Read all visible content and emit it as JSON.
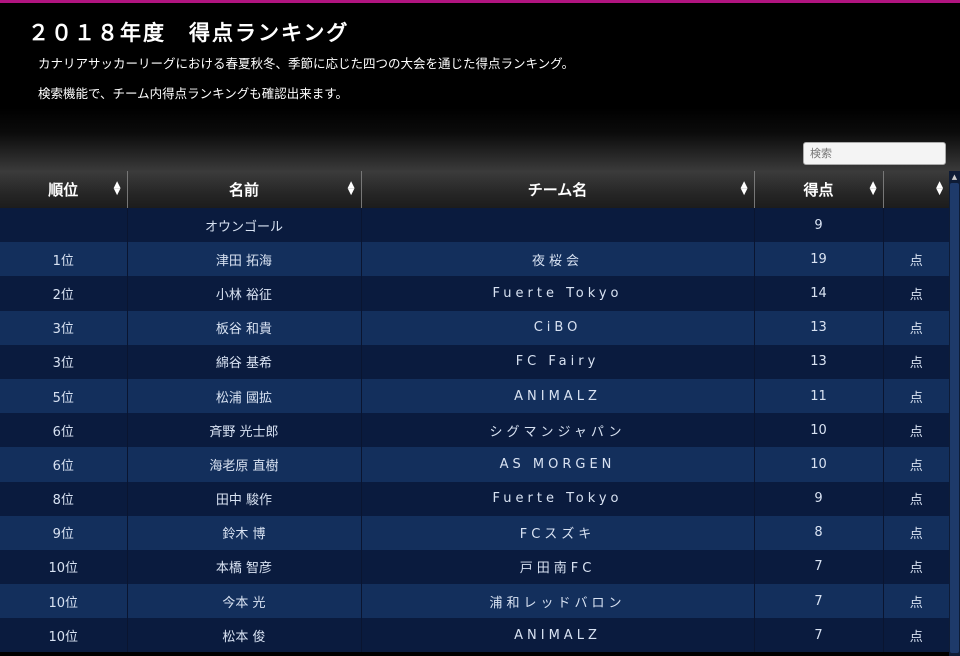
{
  "header": {
    "title": "２０１８年度　得点ランキング",
    "description1": "カナリアサッカーリーグにおける春夏秋冬、季節に応じた四つの大会を通じた得点ランキング。",
    "description2": "検索機能で、チーム内得点ランキングも確認出来ます。"
  },
  "search": {
    "placeholder": "検索"
  },
  "table": {
    "columns": [
      "順位",
      "名前",
      "チーム名",
      "得点",
      ""
    ],
    "rows": [
      {
        "rank": "",
        "name": "オウンゴール",
        "team": "",
        "points": "9",
        "unit": ""
      },
      {
        "rank": "1位",
        "name": "津田 拓海",
        "team": "夜桜会",
        "points": "19",
        "unit": "点"
      },
      {
        "rank": "2位",
        "name": "小林 裕征",
        "team": "Fuerte Tokyo",
        "points": "14",
        "unit": "点"
      },
      {
        "rank": "3位",
        "name": "板谷 和貴",
        "team": "CiBO",
        "points": "13",
        "unit": "点"
      },
      {
        "rank": "3位",
        "name": "綿谷 基希",
        "team": "FC Fairy",
        "points": "13",
        "unit": "点"
      },
      {
        "rank": "5位",
        "name": "松浦 國拡",
        "team": "ANIMALZ",
        "points": "11",
        "unit": "点"
      },
      {
        "rank": "6位",
        "name": "斉野 光士郎",
        "team": "シグマンジャパン",
        "points": "10",
        "unit": "点"
      },
      {
        "rank": "6位",
        "name": "海老原 直樹",
        "team": "AS MORGEN",
        "points": "10",
        "unit": "点"
      },
      {
        "rank": "8位",
        "name": "田中 駿作",
        "team": "Fuerte Tokyo",
        "points": "9",
        "unit": "点"
      },
      {
        "rank": "9位",
        "name": "鈴木 博",
        "team": "FCスズキ",
        "points": "8",
        "unit": "点"
      },
      {
        "rank": "10位",
        "name": "本橋 智彦",
        "team": "戸田南FC",
        "points": "7",
        "unit": "点"
      },
      {
        "rank": "10位",
        "name": "今本 光",
        "team": "浦和レッドバロン",
        "points": "7",
        "unit": "点"
      },
      {
        "rank": "10位",
        "name": "松本 俊",
        "team": "ANIMALZ",
        "points": "7",
        "unit": "点"
      }
    ]
  },
  "icons": {
    "sort": "sort-arrows-icon",
    "scroll": "scroll-up-icon"
  },
  "colors": {
    "accent": "#b0147f",
    "row_odd": "#0a1b3e",
    "row_even": "#132f5c"
  }
}
